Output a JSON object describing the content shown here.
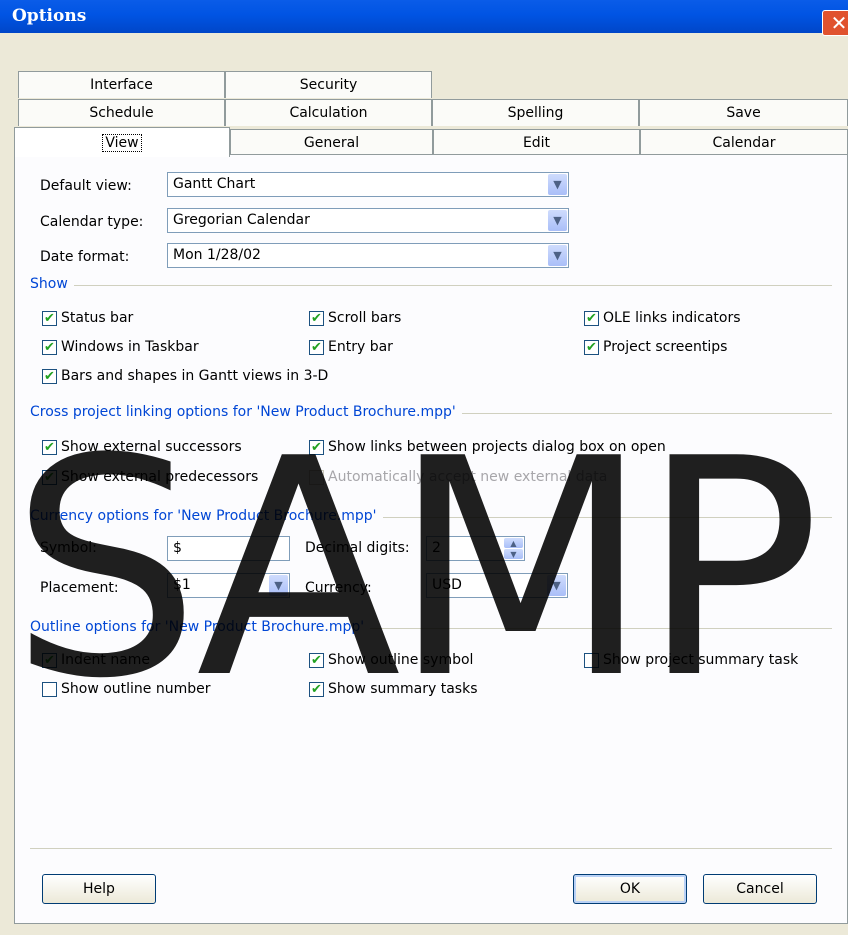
{
  "window": {
    "title": "Options",
    "close_glyph": "✕"
  },
  "tabs": {
    "row1": [
      "Interface",
      "Security"
    ],
    "row2": [
      "Schedule",
      "Calculation",
      "Spelling",
      "Save"
    ],
    "row3": [
      "View",
      "General",
      "Edit",
      "Calendar"
    ],
    "active": "View"
  },
  "view": {
    "default_view": {
      "label": "Default view:",
      "value": "Gantt Chart"
    },
    "calendar_type": {
      "label": "Calendar type:",
      "value": "Gregorian Calendar"
    },
    "date_format": {
      "label": "Date format:",
      "value": "Mon 1/28/02"
    }
  },
  "show": {
    "title": "Show",
    "items": [
      {
        "label": "Status bar",
        "checked": true
      },
      {
        "label": "Windows in Taskbar",
        "checked": true
      },
      {
        "label": "Bars and shapes in Gantt views in 3-D",
        "checked": true
      },
      {
        "label": "Scroll bars",
        "checked": true
      },
      {
        "label": "Entry bar",
        "checked": true
      },
      {
        "label": "OLE links indicators",
        "checked": true
      },
      {
        "label": "Project screentips",
        "checked": true
      }
    ]
  },
  "cross": {
    "title": "Cross project linking options for 'New Product Brochure.mpp'",
    "items": [
      {
        "label": "Show external successors",
        "checked": true
      },
      {
        "label": "Show external predecessors",
        "checked": true
      },
      {
        "label": "Show links between projects dialog box on open",
        "checked": true
      },
      {
        "label": "Automatically accept new external data",
        "checked": false,
        "disabled": true
      }
    ]
  },
  "currency": {
    "title": "Currency options for 'New Product Brochure.mpp'",
    "symbol_label": "Symbol:",
    "symbol_value": "$",
    "placement_label": "Placement:",
    "placement_value": "$1",
    "decimal_label": "Decimal digits:",
    "decimal_value": "2",
    "currency_label": "Currency:",
    "currency_value": "USD"
  },
  "outline": {
    "title": "Outline options for 'New Product Brochure.mpp'",
    "items": [
      {
        "label": "Indent name",
        "checked": true
      },
      {
        "label": "Show outline number",
        "checked": false
      },
      {
        "label": "Show outline symbol",
        "checked": true
      },
      {
        "label": "Show summary tasks",
        "checked": true
      },
      {
        "label": "Show project summary task",
        "checked": false
      }
    ]
  },
  "buttons": {
    "help": "Help",
    "ok": "OK",
    "cancel": "Cancel"
  },
  "watermark": "SAMP",
  "glyphs": {
    "check": "✔",
    "dropdown": "▼",
    "spin_up": "▲",
    "spin_down": "▼"
  },
  "colors": {
    "titlebar": "#0054e3",
    "section": "#0046d5",
    "check": "#21a121"
  }
}
